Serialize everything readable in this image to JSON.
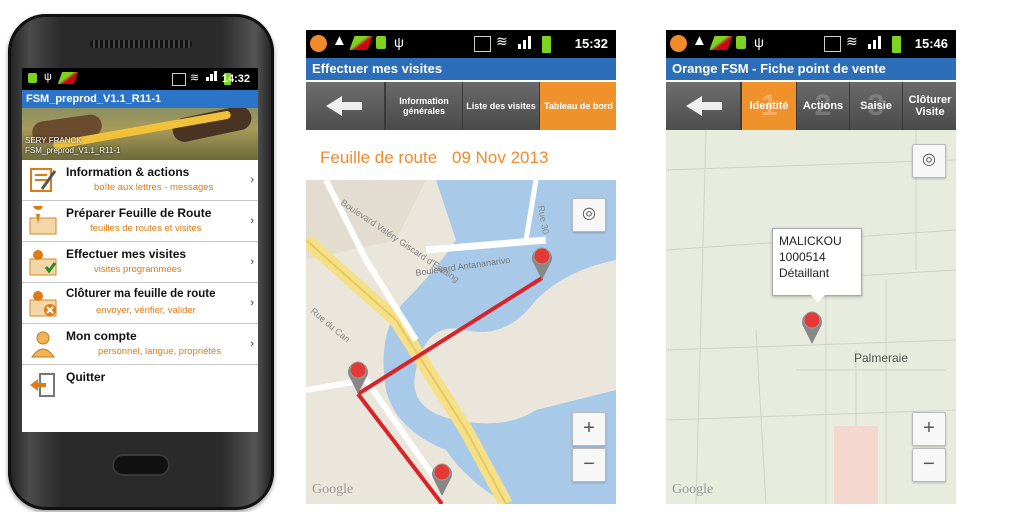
{
  "phone1": {
    "status": {
      "time": "14:32"
    },
    "title": "FSM_preprod_V1.1_R11-1",
    "banner": {
      "user": "SERY FRANCK",
      "version": "FSM_preprod_V1.1_R11-1"
    },
    "menu": [
      {
        "title": "Information & actions",
        "subtitle": "boîte aux lettres - messages",
        "icon": "info-actions-icon"
      },
      {
        "title": "Préparer Feuille de Route",
        "subtitle": "feuilles de routes et visites",
        "icon": "map-prepare-icon"
      },
      {
        "title": "Effectuer mes visites",
        "subtitle": "visites programmées",
        "icon": "map-visits-icon"
      },
      {
        "title": "Clôturer ma feuille de route",
        "subtitle": "envoyer, vérifier, valider",
        "icon": "map-close-icon"
      },
      {
        "title": "Mon compte",
        "subtitle": "personnel, langue, propriétés",
        "icon": "user-account-icon"
      },
      {
        "title": "Quitter",
        "subtitle": "",
        "icon": "exit-icon"
      }
    ],
    "chevron": "›"
  },
  "phone2": {
    "status": {
      "time": "15:32"
    },
    "title": "Effectuer mes visites",
    "tabs": [
      {
        "label": "Information générales",
        "active": false
      },
      {
        "label": "Liste des visites",
        "active": false
      },
      {
        "label": "Tableau de bord",
        "active": true
      }
    ],
    "route_label": "Feuille de route",
    "route_date": "09 Nov 2013",
    "map": {
      "streets": [
        "Boulevard Antananarivo",
        "Boulevard Valéry Giscard d'Estaing",
        "Rue du Can",
        "Rue 30"
      ],
      "zoom_in": "+",
      "zoom_out": "−",
      "watermark": "Google"
    }
  },
  "phone3": {
    "status": {
      "time": "15:46"
    },
    "title": "Orange FSM - Fiche point de vente",
    "tabs": [
      {
        "label": "Identité",
        "num": "1",
        "active": true
      },
      {
        "label": "Actions",
        "num": "2",
        "active": false
      },
      {
        "label": "Saisie",
        "num": "3",
        "active": false
      },
      {
        "label": "Clôturer Visite",
        "num": "",
        "active": false
      }
    ],
    "callout": {
      "name": "MALICKOU",
      "code": "1000514",
      "type": "Détaillant"
    },
    "map": {
      "area": "Palmeraie",
      "zoom_in": "+",
      "zoom_out": "−",
      "watermark": "Google"
    }
  },
  "colors": {
    "accent_orange": "#f0922c",
    "title_blue": "#2c6fb8",
    "route_red": "#d9232a"
  }
}
